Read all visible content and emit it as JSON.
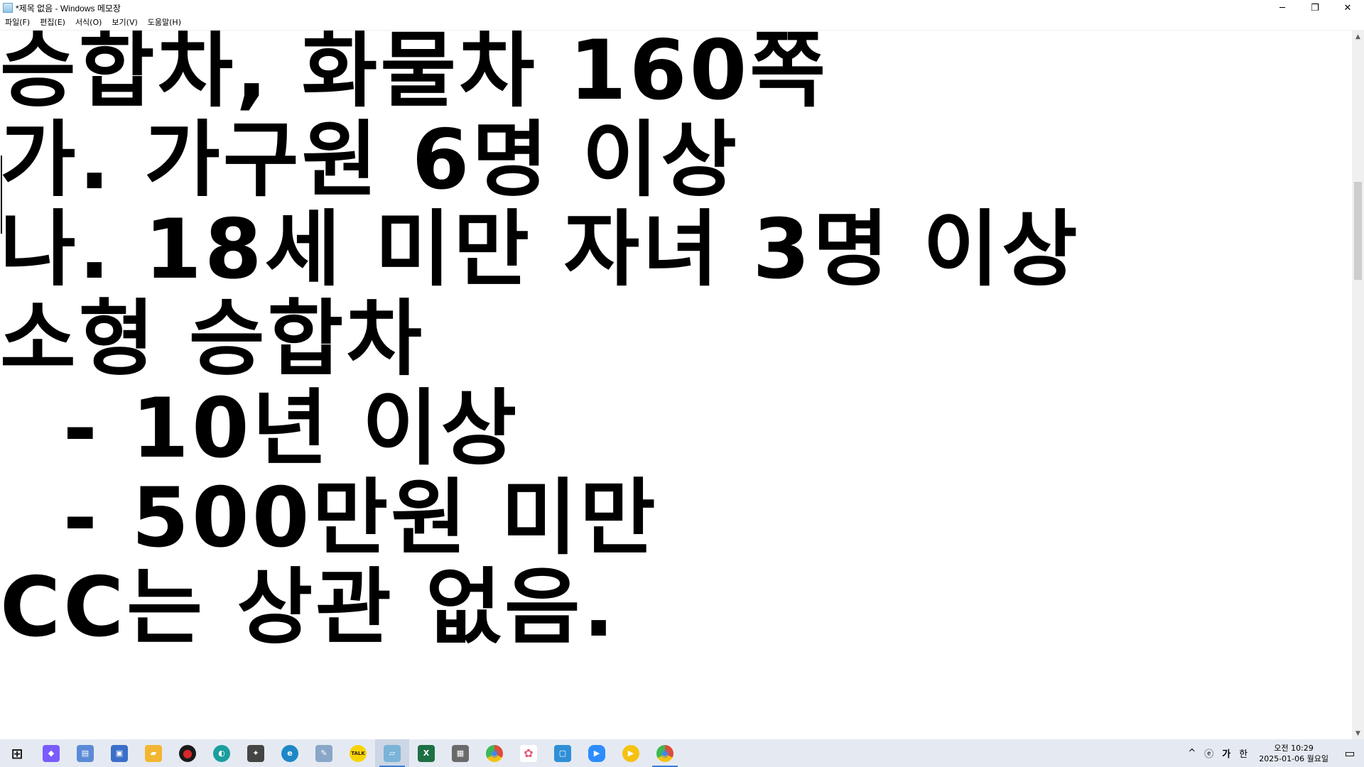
{
  "window": {
    "title": "*제목 없음 - Windows 메모장",
    "controls": {
      "minimize": "─",
      "restore": "❐",
      "close": "✕"
    }
  },
  "menu": [
    "파일(F)",
    "편집(E)",
    "서식(O)",
    "보기(V)",
    "도움말(H)"
  ],
  "document": {
    "lines": [
      "승합차, 화물차 160쪽",
      "가. 가구원 6명 이상",
      "나. 18세 미만 자녀 3명 이상",
      "소형 승합차",
      "  - 10년 이상",
      "  - 500만원 미만",
      "CC는 상관 없음."
    ]
  },
  "scrollbar": {
    "up": "▲",
    "down": "▼"
  },
  "taskbar": {
    "apps": [
      {
        "name": "start",
        "glyph": "⊞",
        "color": "#1a1a1a"
      },
      {
        "name": "copilot",
        "glyph": "◆",
        "color": "#7a5cff"
      },
      {
        "name": "app-blue-1",
        "glyph": "▤",
        "color": "#5b8bd6"
      },
      {
        "name": "app-blue-2",
        "glyph": "▣",
        "color": "#3a6fc9"
      },
      {
        "name": "file-explorer",
        "glyph": "▰",
        "color": "#f2b632"
      },
      {
        "name": "recorder",
        "glyph": "●",
        "color": "#d62828"
      },
      {
        "name": "app-teal",
        "glyph": "◐",
        "color": "#1a9e9e"
      },
      {
        "name": "davinci",
        "glyph": "✦",
        "color": "#444444"
      },
      {
        "name": "edge",
        "glyph": "e",
        "color": "#1e88c7"
      },
      {
        "name": "paint",
        "glyph": "✎",
        "color": "#8aa6c8"
      },
      {
        "name": "kakaotalk",
        "glyph": "TALK",
        "color": "#f7d400"
      },
      {
        "name": "notepad",
        "glyph": "▱",
        "color": "#7ab4d8"
      },
      {
        "name": "excel",
        "glyph": "X",
        "color": "#1d7044"
      },
      {
        "name": "calculator",
        "glyph": "▦",
        "color": "#6a6a6a"
      },
      {
        "name": "chrome-1",
        "glyph": "◉",
        "color": "#dd4b39"
      },
      {
        "name": "app-pinwheel",
        "glyph": "✿",
        "color": "#e05a7a"
      },
      {
        "name": "app-blue-3",
        "glyph": "▢",
        "color": "#2f8fd6"
      },
      {
        "name": "zoom",
        "glyph": "▶",
        "color": "#2d8cff"
      },
      {
        "name": "media-player",
        "glyph": "▶",
        "color": "#f5c211"
      },
      {
        "name": "chrome-2",
        "glyph": "◉",
        "color": "#dd4b39"
      }
    ],
    "tray": {
      "chevron": "^",
      "ime_1": "ⓔ",
      "ime_2": "가",
      "ime_3": "한",
      "time": "오전 10:29",
      "date": "2025-01-06 월요일",
      "notification": "▭"
    }
  }
}
